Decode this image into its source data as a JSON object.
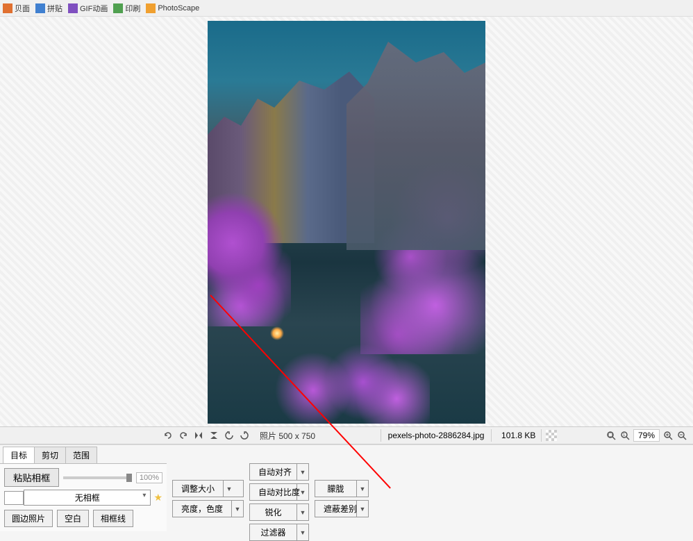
{
  "toolbar": {
    "items": [
      {
        "label": "贝面",
        "icon": "#e07030"
      },
      {
        "label": "拼贴",
        "icon": "#4080d0"
      },
      {
        "label": "GIF动画",
        "icon": "#8050c0"
      },
      {
        "label": "印刷",
        "icon": "#50a050"
      },
      {
        "label": "PhotoScape",
        "icon": "#f0a030"
      }
    ]
  },
  "status": {
    "dimensions": "照片 500 x 750",
    "filename": "pexels-photo-2886284.jpg",
    "filesize": "101.8 KB",
    "zoom": "79%"
  },
  "tabs": {
    "items": [
      "目标",
      "剪切",
      "范围"
    ],
    "active": 0
  },
  "left": {
    "paste": "粘贴相框",
    "slider_pct": "100%",
    "frame_option": "无相框",
    "buttons": [
      "圆边照片",
      "空白",
      "相框线"
    ]
  },
  "mid": {
    "col1": [
      "调整大小",
      "亮度，色度"
    ],
    "col2": [
      "自动对齐",
      "自动对比度",
      "锐化",
      "过滤器"
    ],
    "col3": [
      "朦胧",
      "遮蔽差别"
    ]
  }
}
